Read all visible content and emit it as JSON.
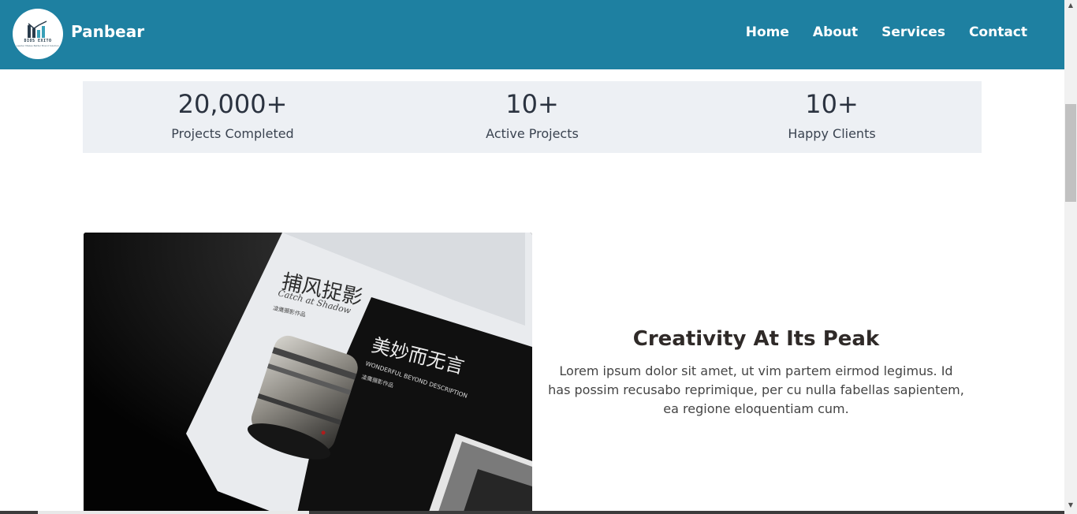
{
  "header": {
    "brand": "Panbear",
    "logo_text": "DIOS EXITO",
    "logo_tagline": "Leader Makes Better Brand Solution",
    "nav": [
      "Home",
      "About",
      "Services",
      "Contact"
    ],
    "background": "#1e80a1"
  },
  "stats": [
    {
      "value": "20,000+",
      "label": "Projects Completed"
    },
    {
      "value": "10+",
      "label": "Active Projects"
    },
    {
      "value": "10+",
      "label": "Happy Clients"
    }
  ],
  "feature": {
    "title": "Creativity At Its Peak",
    "body": "Lorem ipsum dolor sit amet, ut vim partem eirmod legimus. Id has possim recusabo reprimique, per cu nulla fabellas sapientem, ea regione eloquentiam cum.",
    "photo": {
      "book1_title": "捕风捉影",
      "book1_subtitle": "Catch at Shadow",
      "book1_caption": "凌鹰摄影作品",
      "book2_title": "美妙而无言",
      "book2_subtitle": "WONDERFUL BEYOND DESCRIPTION",
      "book2_caption": "凌鹰摄影作品"
    }
  },
  "icons": {
    "scroll_up": "chevron-up-icon",
    "scroll_down": "chevron-down-icon"
  }
}
